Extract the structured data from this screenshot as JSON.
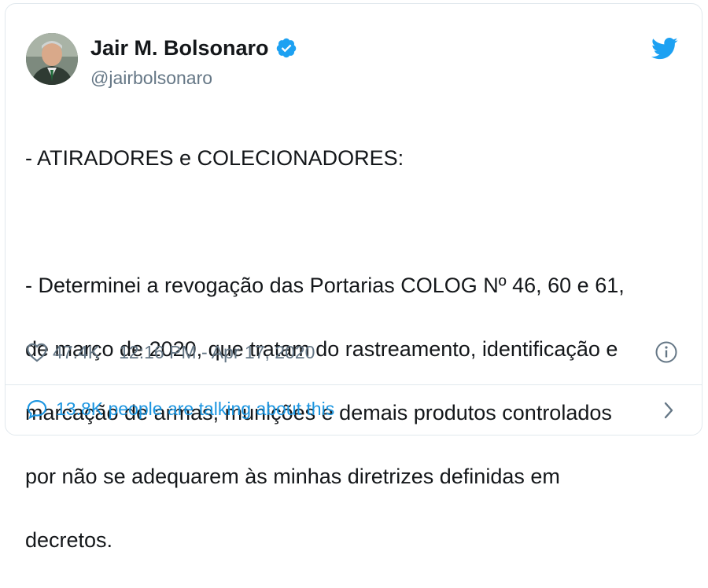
{
  "author": {
    "display_name": "Jair M. Bolsonaro",
    "handle": "@jairbolsonaro",
    "verified": true,
    "avatar": "profile-photo"
  },
  "tweet": {
    "lines": [
      "- ATIRADORES e COLECIONADORES:",
      "",
      "- Determinei a revogação das Portarias COLOG Nº 46, 60 e 61,",
      "de março de 2020, que tratam do rastreamento, identificação e",
      "marcação de armas, munições e demais produtos controlados",
      "por não se adequarem às minhas diretrizes definidas em",
      "decretos."
    ]
  },
  "meta": {
    "like_count": "47.4K",
    "timestamp": "12:16 PM - Apr 17, 2020"
  },
  "conversation": {
    "label": "13.8K people are talking about this"
  },
  "icons": {
    "brand": "twitter-bird-icon",
    "verified": "verified-badge-icon",
    "like": "heart-icon",
    "info": "info-icon",
    "conversation": "speech-bubble-icon",
    "navigate": "chevron-right-icon"
  },
  "colors": {
    "text": "#14171a",
    "secondary": "#657786",
    "accent": "#1b95e0",
    "twitter_blue": "#1da1f2",
    "border": "#e1e8ed"
  }
}
